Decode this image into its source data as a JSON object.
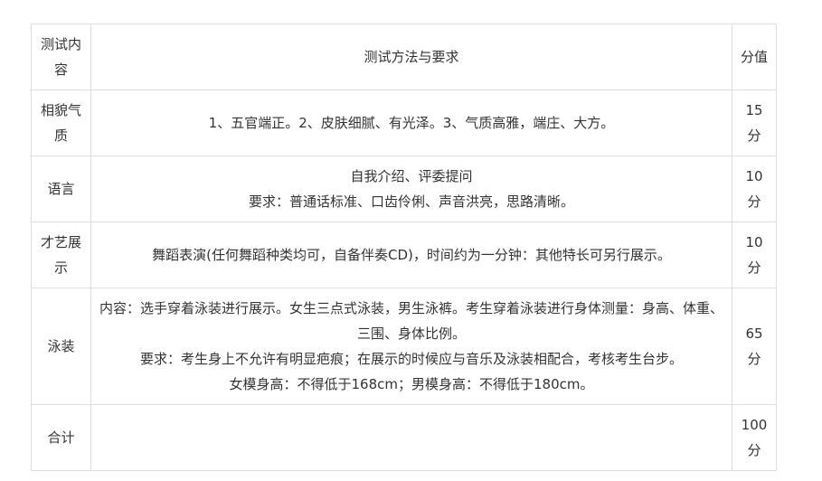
{
  "table": {
    "headers": {
      "content": "测试内容",
      "method": "测试方法与要求",
      "score": "分值"
    },
    "rows": [
      {
        "category": "相貌气质",
        "lines": [
          "1、五官端正。2、皮肤细腻、有光泽。3、气质高雅，端庄、大方。"
        ],
        "score": "15分"
      },
      {
        "category": "语言",
        "lines": [
          "自我介绍、评委提问",
          "要求：普通话标准、口齿伶俐、声音洪亮，思路清晰。"
        ],
        "score": "10分"
      },
      {
        "category": "才艺展示",
        "lines": [
          "舞蹈表演(任何舞蹈种类均可，自备伴奏CD)，时间约为一分钟：其他特长可另行展示。"
        ],
        "score": "10分"
      },
      {
        "category": "泳装",
        "lines": [
          "内容：选手穿着泳装进行展示。女生三点式泳装，男生泳裤。考生穿着泳装进行身体测量：身高、体重、三围、身体比例。",
          "要求：考生身上不允许有明显疤痕；在展示的时候应与音乐及泳装相配合，考核考生台步。",
          "女模身高：不得低于168cm；男模身高：不得低于180cm。"
        ],
        "score": "65分"
      },
      {
        "category": "合计",
        "lines": [
          ""
        ],
        "score": "100分"
      }
    ]
  }
}
